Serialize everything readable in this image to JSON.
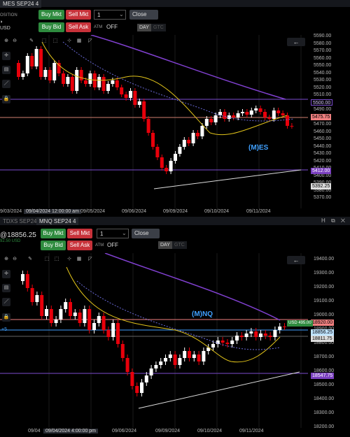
{
  "top": {
    "tab_title": "MES SEP24 4",
    "position_label": "OSITION",
    "position_sub": "USD",
    "buy_mkt": "Buy Mkt",
    "sell_mkt": "Sell Mkt",
    "qty": "1",
    "close": "Close",
    "buy_bid": "Buy Bid",
    "sell_ask": "Sell Ask",
    "atm_label": "ATM",
    "atm_value": "OFF",
    "tif_day": "DAY",
    "tif_gtc": "GTC",
    "symbol_overlay": "(M)ES",
    "price_labels": [
      "5590.00",
      "5580.00",
      "5570.00",
      "5560.00",
      "5550.00",
      "5540.00",
      "5530.00",
      "5520.00",
      "5510.00",
      "5500.00",
      "5490.00",
      "5480.00",
      "5470.00",
      "5460.00",
      "5450.00",
      "5440.00",
      "5430.00",
      "5420.00",
      "5410.00",
      "5400.00",
      "5390.00",
      "5380.00",
      "5370.00"
    ],
    "tags": {
      "upper": "5500.00",
      "current": "5475.75",
      "lower": "5412.00",
      "bottom": "5392.25"
    },
    "x_labels": [
      "9/03/2024",
      "09/04/2024 12:00:00 am",
      "09/05/2024",
      "09/06/2024",
      "09/09/2024",
      "09/10/2024",
      "09/11/2024"
    ]
  },
  "bottom": {
    "tab_inactive": "TDXS SEP24 4",
    "tab_active": "MNQ SEP24 4",
    "position_value": "@18856.25",
    "position_sub": "92.50 USD",
    "pos_marker": "+5",
    "buy_mkt": "Buy Mkt",
    "sell_mkt": "Sell Mkt",
    "qty": "1",
    "close": "Close",
    "buy_bid": "Buy Bid",
    "sell_ask": "Sell Ask",
    "atm_label": "ATM",
    "atm_value": "OFF",
    "tif_day": "DAY",
    "tif_gtc": "GTC",
    "symbol_overlay": "(M)NQ",
    "price_labels": [
      "19400.00",
      "19300.00",
      "19200.00",
      "19100.00",
      "19000.00",
      "18900.00",
      "18800.00",
      "18700.00",
      "18600.00",
      "18500.00",
      "18400.00",
      "18300.00",
      "18200.00"
    ],
    "tags": {
      "upper": "18920.00",
      "pnl": "USD 495.00",
      "current": "18856.25",
      "mid": "18811.75",
      "lower": "18547.75"
    },
    "x_labels": [
      "09/04",
      "09/04/2024 4:00:00 pm",
      "09/06/2024",
      "09/09/2024",
      "09/10/2024",
      "09/11/2024"
    ]
  },
  "colors": {
    "bull": "#ffffff",
    "bear": "#e8000b",
    "ma_fast": "#e0c21a",
    "ma_slow": "#8040d0",
    "accent": "#3fa0ff"
  }
}
